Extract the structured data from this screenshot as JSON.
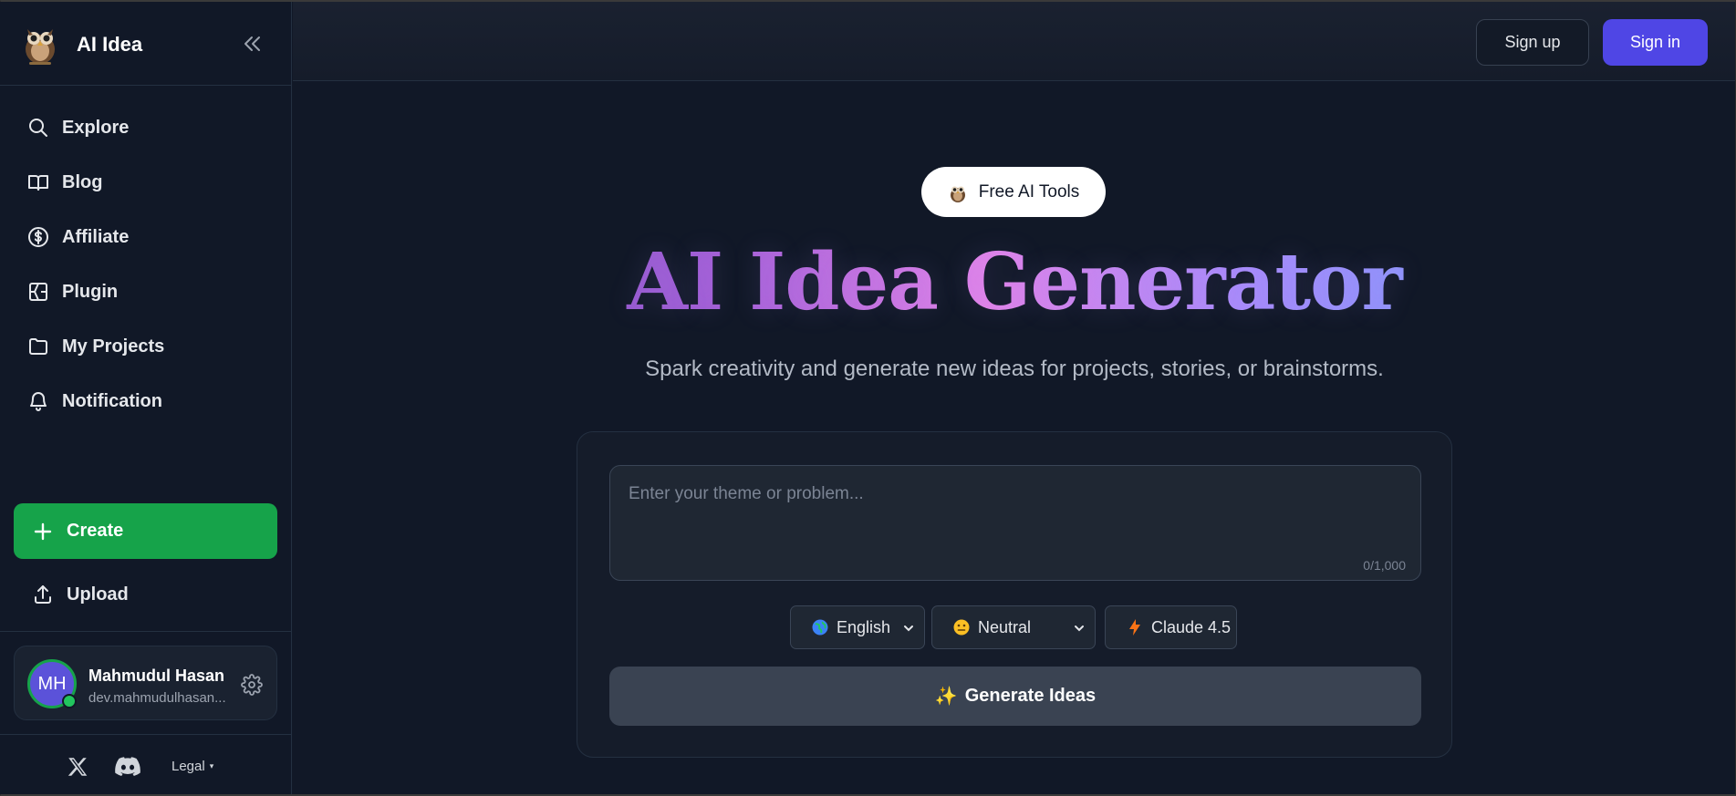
{
  "brand": {
    "name": "AI Idea",
    "logo": "owl-logo"
  },
  "sidebar": {
    "collapse_icon": "double-chevron-left-icon",
    "items": [
      {
        "label": "Explore",
        "icon": "search-icon"
      },
      {
        "label": "Blog",
        "icon": "book-open-icon"
      },
      {
        "label": "Affiliate",
        "icon": "dollar-circle-icon"
      },
      {
        "label": "Plugin",
        "icon": "plugin-icon"
      },
      {
        "label": "My Projects",
        "icon": "folder-icon"
      },
      {
        "label": "Notification",
        "icon": "bell-icon"
      }
    ],
    "create_label": "Create",
    "upload_label": "Upload"
  },
  "user": {
    "initials": "MH",
    "name": "Mahmudul Hasan",
    "email": "dev.mahmudulhasan...",
    "status": "online"
  },
  "footer": {
    "legal_label": "Legal",
    "caret": "▾"
  },
  "header": {
    "signup_label": "Sign up",
    "signin_label": "Sign in"
  },
  "main": {
    "badge_label": "Free AI Tools",
    "title": "AI Idea Generator",
    "subtitle": "Spark creativity and generate new ideas for projects, stories, or brainstorms.",
    "input": {
      "placeholder": "Enter your theme or problem...",
      "value": "",
      "char_count": "0/1,000"
    },
    "language": {
      "selected": "English",
      "icon": "globe-icon"
    },
    "tone": {
      "selected": "Neutral",
      "icon": "neutral-face-icon"
    },
    "model": {
      "selected": "Claude 4.5",
      "icon": "lightning-icon"
    },
    "generate_label": "Generate Ideas",
    "generate_icon": "✨"
  },
  "colors": {
    "background": "#111827",
    "create_green": "#16a34a",
    "signin_indigo": "#4f46e5",
    "generate_button": "#3a4352"
  }
}
